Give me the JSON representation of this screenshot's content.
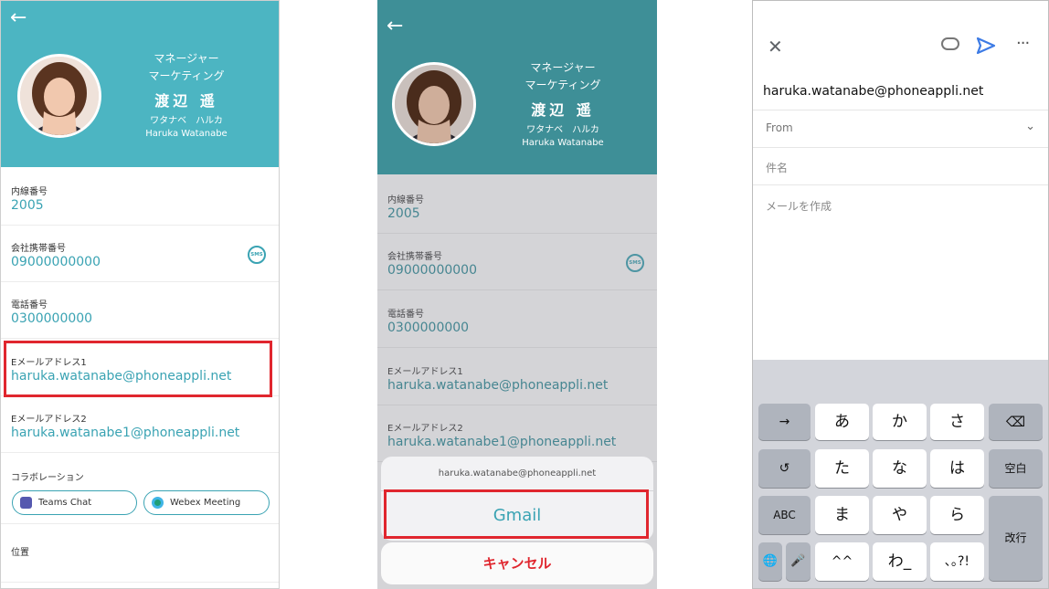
{
  "profile": {
    "title_line1": "マネージャー",
    "title_line2": "マーケティング",
    "name": "渡辺 遥",
    "kana": "ワタナベ　ハルカ",
    "romaji": "Haruka Watanabe"
  },
  "fields": [
    {
      "label": "内線番号",
      "value": "2005"
    },
    {
      "label": "会社携帯番号",
      "value": "09000000000"
    },
    {
      "label": "電話番号",
      "value": "0300000000"
    },
    {
      "label": "Eメールアドレス1",
      "value": "haruka.watanabe@phoneappli.net"
    },
    {
      "label": "Eメールアドレス2",
      "value": "haruka.watanabe1@phoneappli.net"
    }
  ],
  "sms_label": "SMS",
  "collab": {
    "label": "コラボレーション",
    "teams": "Teams Chat",
    "webex": "Webex Meeting"
  },
  "location_label": "位置",
  "action_sheet": {
    "title": "haruka.watanabe@phoneappli.net",
    "gmail": "Gmail",
    "cancel": "キャンセル"
  },
  "compose": {
    "to": "haruka.watanabe@phoneappli.net",
    "from_label": "From",
    "subject_placeholder": "件名",
    "body_placeholder": "メールを作成"
  },
  "keyboard": {
    "row1": [
      "→",
      "あ",
      "か",
      "さ",
      "⌫"
    ],
    "row2": [
      "↺",
      "た",
      "な",
      "は",
      "空白"
    ],
    "row3": [
      "ABC",
      "ま",
      "や",
      "ら",
      "改行"
    ],
    "row4": [
      "🌐",
      "🎤",
      "^^",
      "わ_",
      "､｡?!"
    ]
  },
  "colors": {
    "accent": "#4cb5c2",
    "highlight": "#e0262e",
    "send": "#3d7be5"
  }
}
